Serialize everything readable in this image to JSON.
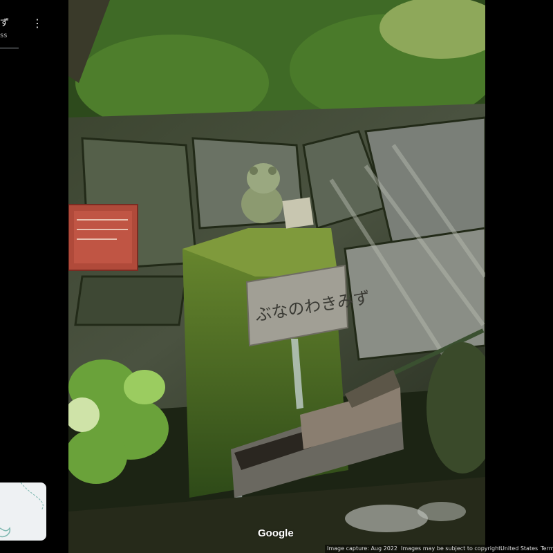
{
  "place": {
    "title": "ず",
    "subtitle": "ss"
  },
  "photo": {
    "sign_text": "ぶなのわきみず"
  },
  "watermark": "Google",
  "footer": {
    "capture": "Image capture: Aug 2022",
    "copyright": "Images may be subject to copyright.",
    "region": "United States",
    "terms": "Terms"
  }
}
